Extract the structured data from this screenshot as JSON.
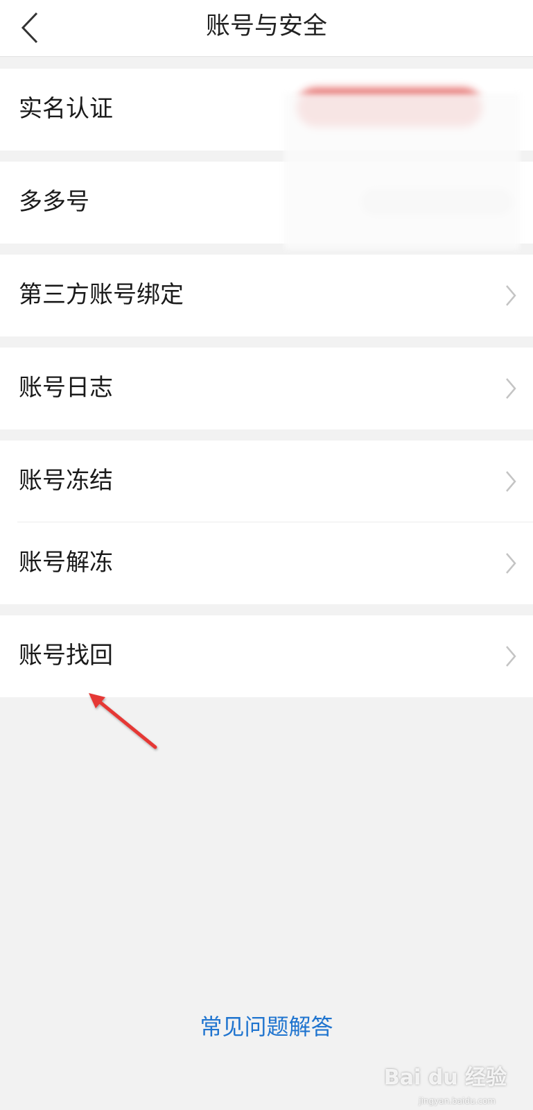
{
  "header": {
    "title": "账号与安全"
  },
  "rows": [
    {
      "label": "实名认证"
    },
    {
      "label": "多多号"
    },
    {
      "label": "第三方账号绑定"
    },
    {
      "label": "账号日志"
    },
    {
      "label": "账号冻结"
    },
    {
      "label": "账号解冻"
    },
    {
      "label": "账号找回"
    }
  ],
  "faq": {
    "label": "常见问题解答"
  },
  "watermark": {
    "brand": "Bai du 经验",
    "url": "jingyan.baidu.com"
  },
  "colors": {
    "link": "#1f74cf",
    "annotation_arrow": "#e53935",
    "background": "#f2f2f2"
  },
  "icons": {
    "back": "chevron-left-icon",
    "row_arrow": "chevron-right-icon"
  }
}
